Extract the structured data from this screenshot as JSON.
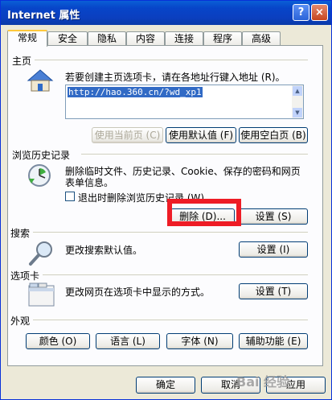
{
  "window": {
    "title": "Internet 属性",
    "help_label": "?",
    "close_label": "×"
  },
  "tabs": [
    "常规",
    "安全",
    "隐私",
    "内容",
    "连接",
    "程序",
    "高级"
  ],
  "home": {
    "group_label": "主页",
    "description": "若要创建主页选项卡，请在各地址行键入地址 (R)。",
    "url_value": "http://hao.360.cn/?wd_xp1",
    "btn_current": "使用当前页 (C)",
    "btn_default": "使用默认值 (F)",
    "btn_blank": "使用空白页 (B)"
  },
  "history": {
    "group_label": "浏览历史记录",
    "description_line1": "删除临时文件、历史记录、Cookie、保存的密码和网页",
    "description_line2": "表单信息。",
    "checkbox_label": "退出时删除浏览历史记录 (W)",
    "btn_delete": "删除 (D)...",
    "btn_settings": "设置 (S)"
  },
  "search": {
    "group_label": "搜索",
    "description": "更改搜索默认值。",
    "btn_settings": "设置 (I)"
  },
  "tabs_section": {
    "group_label": "选项卡",
    "description": "更改网页在选项卡中显示的方式。",
    "btn_settings": "设置 (T)"
  },
  "appearance": {
    "group_label": "外观",
    "btn_colors": "颜色 (O)",
    "btn_languages": "语言 (L)",
    "btn_fonts": "字体 (N)",
    "btn_accessibility": "辅助功能 (E)"
  },
  "footer": {
    "btn_ok": "确定",
    "btn_cancel": "取消",
    "btn_apply": "应用"
  },
  "watermark": "Bai 经验"
}
